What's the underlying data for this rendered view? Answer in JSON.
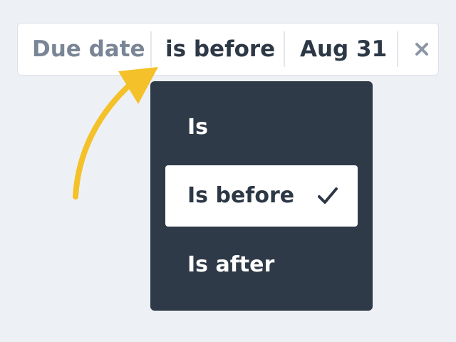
{
  "filter": {
    "field_label": "Due date",
    "operator_label": "is before",
    "value_label": "Aug 31",
    "remove_icon": "close-icon"
  },
  "dropdown": {
    "options": [
      {
        "label": "Is",
        "selected": false
      },
      {
        "label": "Is before",
        "selected": true
      },
      {
        "label": "Is after",
        "selected": false
      }
    ],
    "selected_icon": "checkmark-icon"
  },
  "annotation": {
    "icon": "curved-arrow-icon",
    "color": "#f4c12a"
  },
  "colors": {
    "background": "#edf0f4",
    "chip_background": "#ffffff",
    "field_text": "#7a8595",
    "value_text": "#2d3846",
    "menu_background": "#2f3a48",
    "menu_text": "#ffffff"
  }
}
